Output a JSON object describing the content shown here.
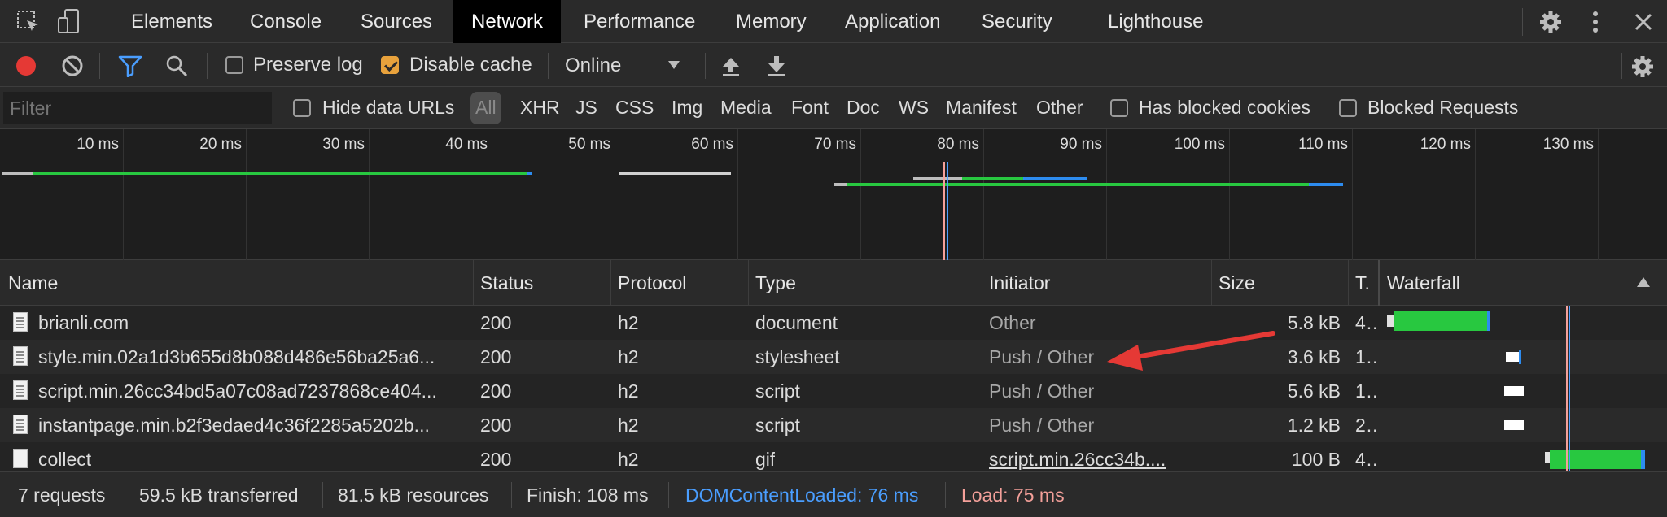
{
  "tabs": [
    "Elements",
    "Console",
    "Sources",
    "Network",
    "Performance",
    "Memory",
    "Application",
    "Security",
    "Lighthouse"
  ],
  "active_tab": "Network",
  "toolbar": {
    "preserve_log": "Preserve log",
    "disable_cache": "Disable cache",
    "throttling": "Online",
    "preserve_log_checked": false,
    "disable_cache_checked": true
  },
  "filter": {
    "placeholder": "Filter",
    "hide_data_urls": "Hide data URLs",
    "types": [
      "All",
      "XHR",
      "JS",
      "CSS",
      "Img",
      "Media",
      "Font",
      "Doc",
      "WS",
      "Manifest",
      "Other"
    ],
    "has_blocked_cookies": "Has blocked cookies",
    "blocked_requests": "Blocked Requests"
  },
  "overview": {
    "ticks": [
      "10 ms",
      "20 ms",
      "30 ms",
      "40 ms",
      "50 ms",
      "60 ms",
      "70 ms",
      "80 ms",
      "90 ms",
      "100 ms",
      "110 ms",
      "120 ms",
      "130 ms"
    ]
  },
  "table": {
    "columns": {
      "name": "Name",
      "status": "Status",
      "protocol": "Protocol",
      "type": "Type",
      "initiator": "Initiator",
      "size": "Size",
      "time": "T.",
      "waterfall": "Waterfall"
    },
    "rows": [
      {
        "name": "brianli.com",
        "status": "200",
        "protocol": "h2",
        "type": "document",
        "initiator": "Other",
        "size": "5.8 kB",
        "time": "4..."
      },
      {
        "name": "style.min.02a1d3b655d8b088d486e56ba25a6...",
        "status": "200",
        "protocol": "h2",
        "type": "stylesheet",
        "initiator": "Push / Other",
        "size": "3.6 kB",
        "time": "1..."
      },
      {
        "name": "script.min.26cc34bd5a07c08ad7237868ce404...",
        "status": "200",
        "protocol": "h2",
        "type": "script",
        "initiator": "Push / Other",
        "size": "5.6 kB",
        "time": "1..."
      },
      {
        "name": "instantpage.min.b2f3edaed4c36f2285a5202b...",
        "status": "200",
        "protocol": "h2",
        "type": "script",
        "initiator": "Push / Other",
        "size": "1.2 kB",
        "time": "2..."
      },
      {
        "name": "collect",
        "status": "200",
        "protocol": "h2",
        "type": "gif",
        "initiator": "script.min.26cc34b....",
        "size": "100 B",
        "time": "4..."
      }
    ]
  },
  "statusbar": {
    "requests": "7 requests",
    "transferred": "59.5 kB transferred",
    "resources": "81.5 kB resources",
    "finish": "Finish: 108 ms",
    "dom_content_loaded": "DOMContentLoaded: 76 ms",
    "load": "Load: 75 ms"
  },
  "colors": {
    "record": "#e53935",
    "filter_active": "#4a9eff",
    "waterfall_green": "#28c840",
    "waterfall_blue": "#2d8cf0",
    "dcl": "#4a9eff",
    "load": "#f4a09a",
    "annotation_arrow": "#e53935"
  }
}
